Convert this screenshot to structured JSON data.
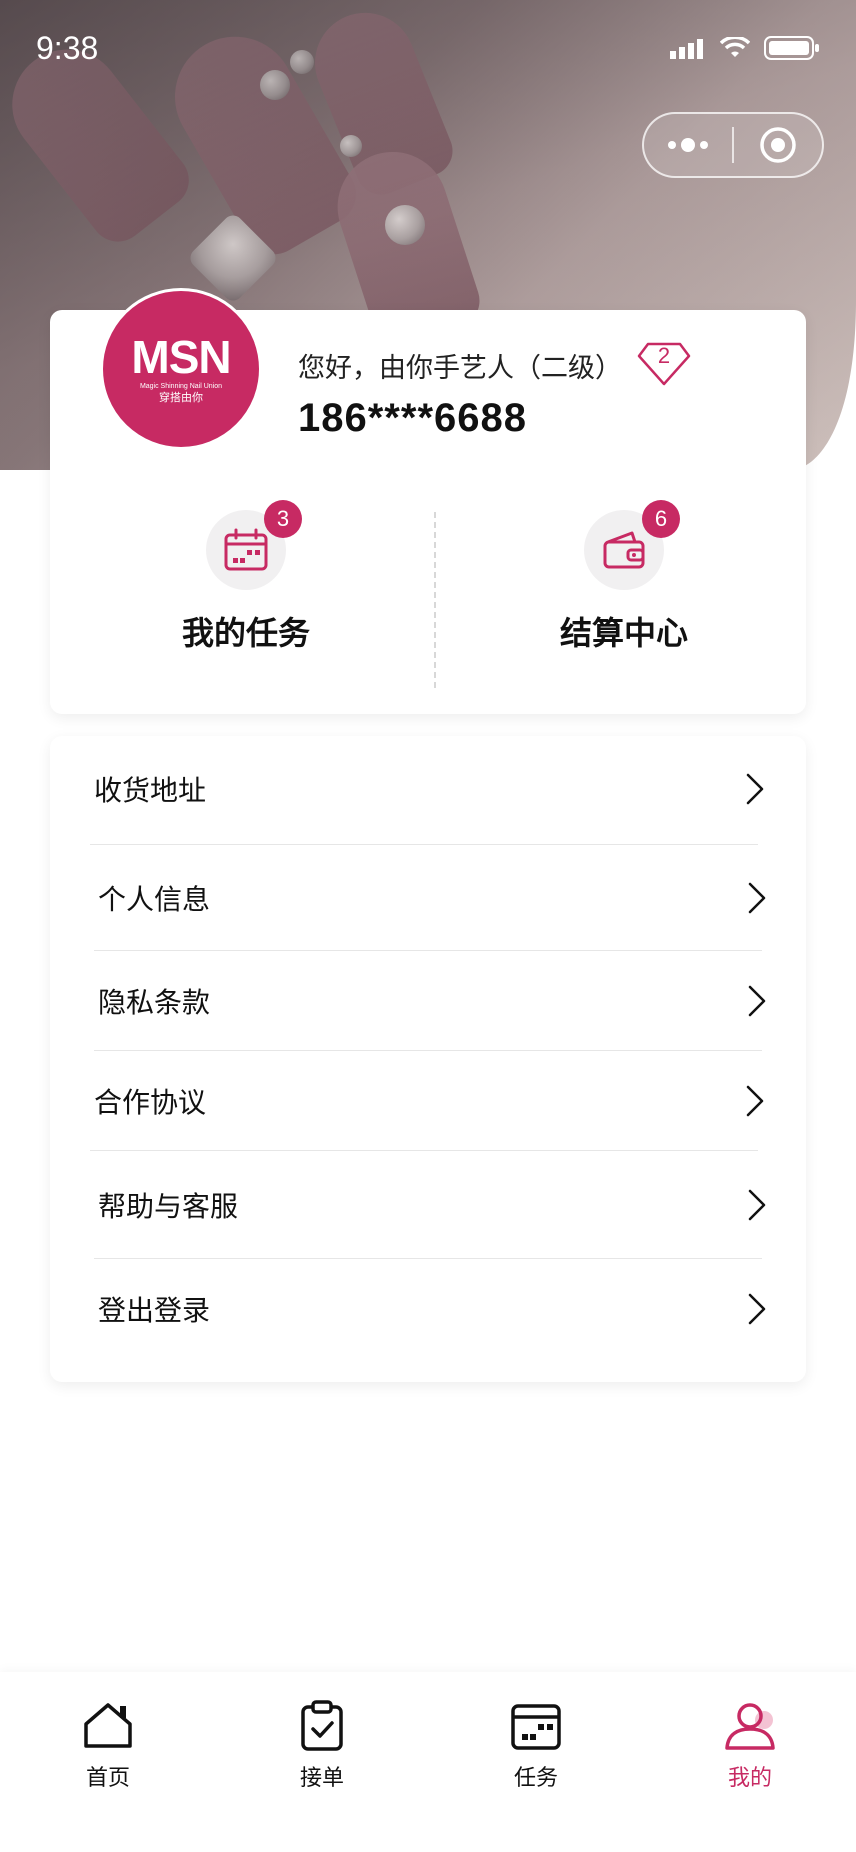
{
  "status_bar": {
    "time": "9:38"
  },
  "profile": {
    "avatar_logo": "MSN",
    "avatar_logo_sub": "Magic Shinning Nail Union",
    "avatar_logo_cn": "穿搭由你",
    "greeting": "您好，由你手艺人（二级）",
    "level": "2",
    "phone": "186****6688"
  },
  "quick_actions": [
    {
      "label": "我的任务",
      "badge": "3"
    },
    {
      "label": "结算中心",
      "badge": "6"
    }
  ],
  "menu": {
    "items": [
      {
        "label": "收货地址"
      },
      {
        "label": "个人信息"
      },
      {
        "label": "隐私条款"
      },
      {
        "label": "合作协议"
      },
      {
        "label": "帮助与客服"
      },
      {
        "label": "登出登录"
      }
    ]
  },
  "tabbar": {
    "items": [
      {
        "label": "首页",
        "icon": "home-icon"
      },
      {
        "label": "接单",
        "icon": "clipboard-check-icon"
      },
      {
        "label": "任务",
        "icon": "calendar-icon"
      },
      {
        "label": "我的",
        "icon": "user-icon",
        "active": true
      }
    ]
  },
  "colors": {
    "accent": "#c72a63",
    "text": "#111111",
    "divider": "#e6e6e6"
  }
}
